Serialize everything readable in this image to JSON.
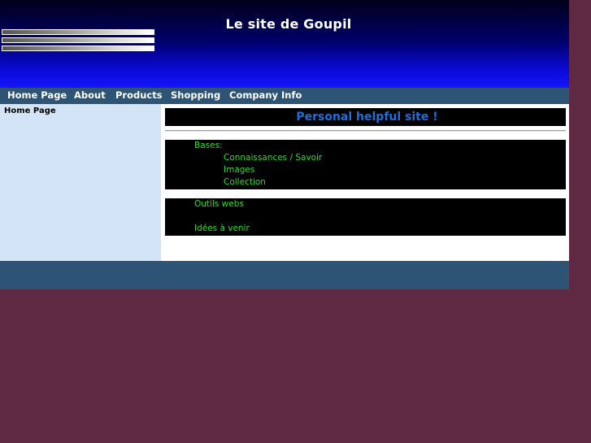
{
  "header": {
    "title": "Le site de Goupil"
  },
  "nav": {
    "items": [
      "Home Page",
      "About",
      "Products",
      "Shopping",
      "Company Info"
    ]
  },
  "sidebar": {
    "items": [
      "Home Page"
    ]
  },
  "main": {
    "headline": "Personal helpful site !",
    "section1": {
      "heading": "Bases:",
      "links": [
        "Connaissances / Savoir",
        "Images",
        "Collection"
      ]
    },
    "section2": {
      "links": [
        "Outils webs",
        "Idées à venir"
      ]
    }
  },
  "colors": {
    "page_background": "#5f2944",
    "nav_background": "#2d5375",
    "sidebar_background": "#d3e4f7",
    "headline_text": "#1e6fdc",
    "content_text": "#22e022",
    "header_gradient_top": "#00001a",
    "header_gradient_bottom": "#1515ff"
  }
}
